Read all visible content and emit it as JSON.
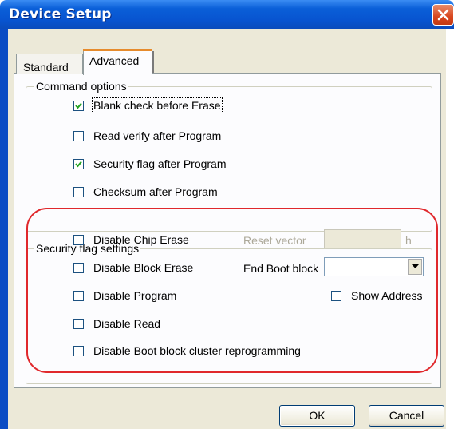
{
  "window": {
    "title": "Device Setup"
  },
  "tabs": {
    "standard": "Standard",
    "advanced": "Advanced"
  },
  "command_options": {
    "legend": "Command options",
    "items": [
      {
        "label": "Blank check before Erase",
        "checked": true
      },
      {
        "label": "Read verify after Program",
        "checked": false
      },
      {
        "label": "Security flag after Program",
        "checked": true
      },
      {
        "label": "Checksum after Program",
        "checked": false
      }
    ]
  },
  "security_flag_settings": {
    "legend": "Security flag settings",
    "items": [
      {
        "label": "Disable Chip Erase",
        "checked": false
      },
      {
        "label": "Disable Block Erase",
        "checked": false
      },
      {
        "label": "Disable Program",
        "checked": false
      },
      {
        "label": "Disable Read",
        "checked": false
      },
      {
        "label": "Disable Boot block cluster reprogramming",
        "checked": false
      }
    ],
    "reset_vector": {
      "label": "Reset vector",
      "value": "",
      "unit": "h"
    },
    "end_boot_block": {
      "label": "End Boot block",
      "value": ""
    },
    "show_address": {
      "label": "Show Address",
      "checked": false
    }
  },
  "buttons": {
    "ok": "OK",
    "cancel": "Cancel"
  },
  "colors": {
    "title_bar": "#0a5fd8",
    "highlight": "#e0282c",
    "client": "#ece9d8"
  },
  "icons": {
    "close": "close-icon",
    "check": "checkmark-icon",
    "dropdown": "chevron-down-icon"
  }
}
